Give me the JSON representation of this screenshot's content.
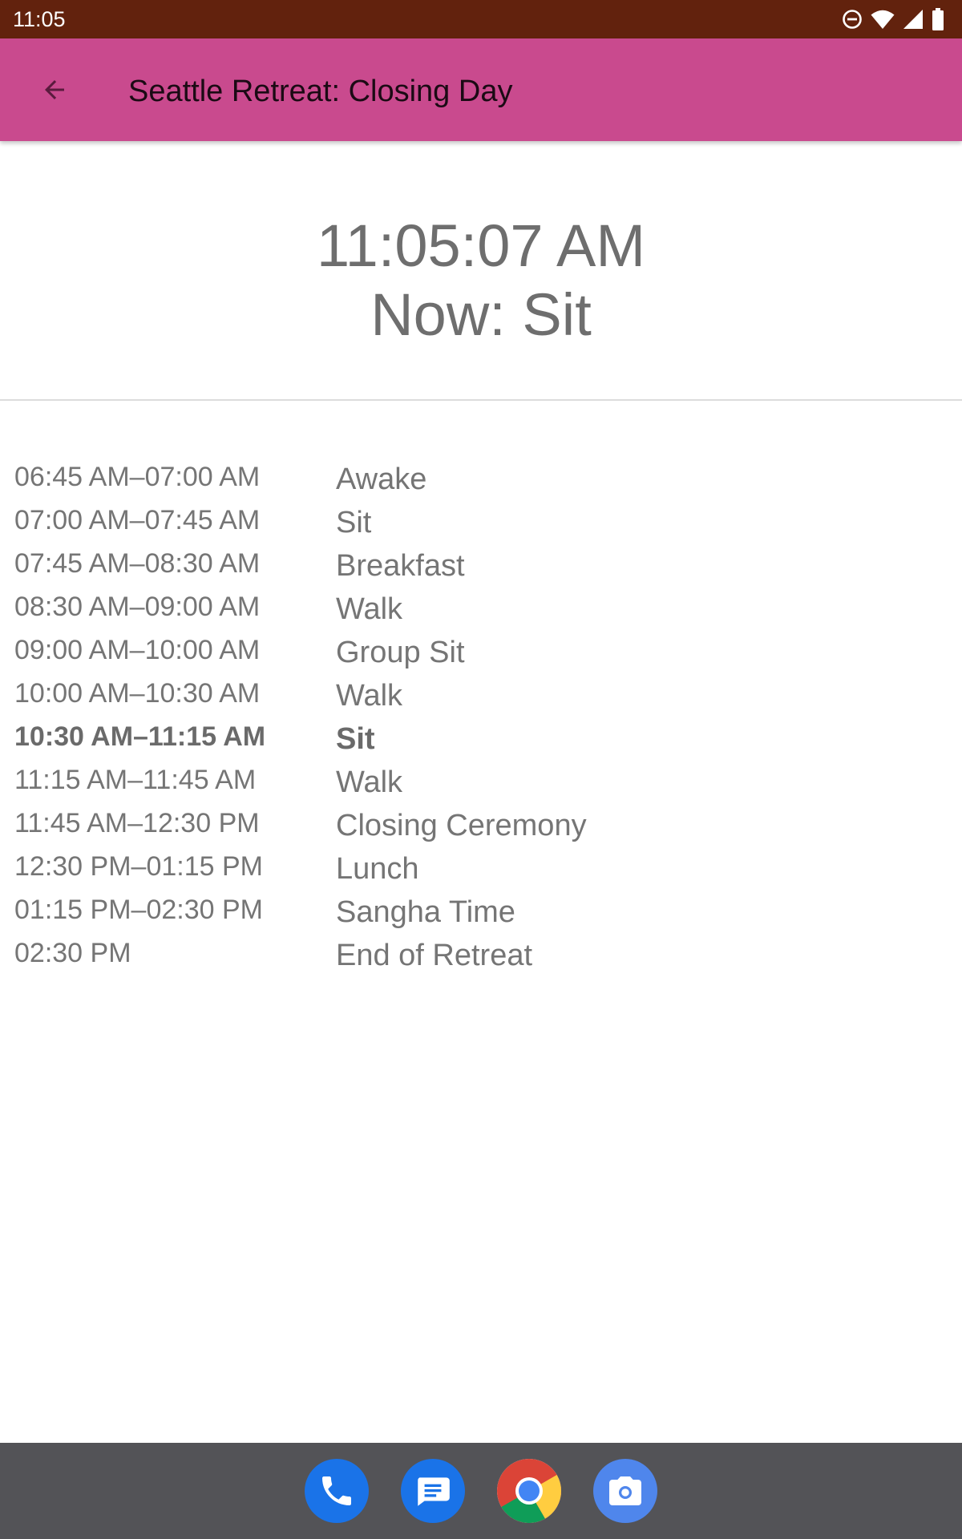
{
  "status_bar": {
    "time": "11:05",
    "icons": [
      "do-not-disturb-icon",
      "wifi-icon",
      "cell-signal-icon",
      "battery-icon"
    ]
  },
  "app_bar": {
    "back_icon": "arrow-back-icon",
    "title": "Seattle Retreat: Closing Day",
    "background_color": "#c94a8e"
  },
  "clock": {
    "time": "11:05:07 AM",
    "now_label": "Now: Sit"
  },
  "schedule": [
    {
      "time": "06:45 AM–07:00 AM",
      "activity": "Awake",
      "current": false
    },
    {
      "time": "07:00 AM–07:45 AM",
      "activity": "Sit",
      "current": false
    },
    {
      "time": "07:45 AM–08:30 AM",
      "activity": "Breakfast",
      "current": false
    },
    {
      "time": "08:30 AM–09:00 AM",
      "activity": "Walk",
      "current": false
    },
    {
      "time": "09:00 AM–10:00 AM",
      "activity": "Group Sit",
      "current": false
    },
    {
      "time": "10:00 AM–10:30 AM",
      "activity": "Walk",
      "current": false
    },
    {
      "time": "10:30 AM–11:15 AM",
      "activity": "Sit",
      "current": true
    },
    {
      "time": "11:15 AM–11:45 AM",
      "activity": "Walk",
      "current": false
    },
    {
      "time": "11:45 AM–12:30 PM",
      "activity": "Closing Ceremony",
      "current": false
    },
    {
      "time": "12:30 PM–01:15 PM",
      "activity": "Lunch",
      "current": false
    },
    {
      "time": "01:15 PM–02:30 PM",
      "activity": "Sangha Time",
      "current": false
    },
    {
      "time": "02:30 PM",
      "activity": "End of Retreat",
      "current": false
    }
  ],
  "dock": {
    "apps": [
      "phone-app-icon",
      "messages-app-icon",
      "chrome-app-icon",
      "camera-app-icon"
    ]
  }
}
